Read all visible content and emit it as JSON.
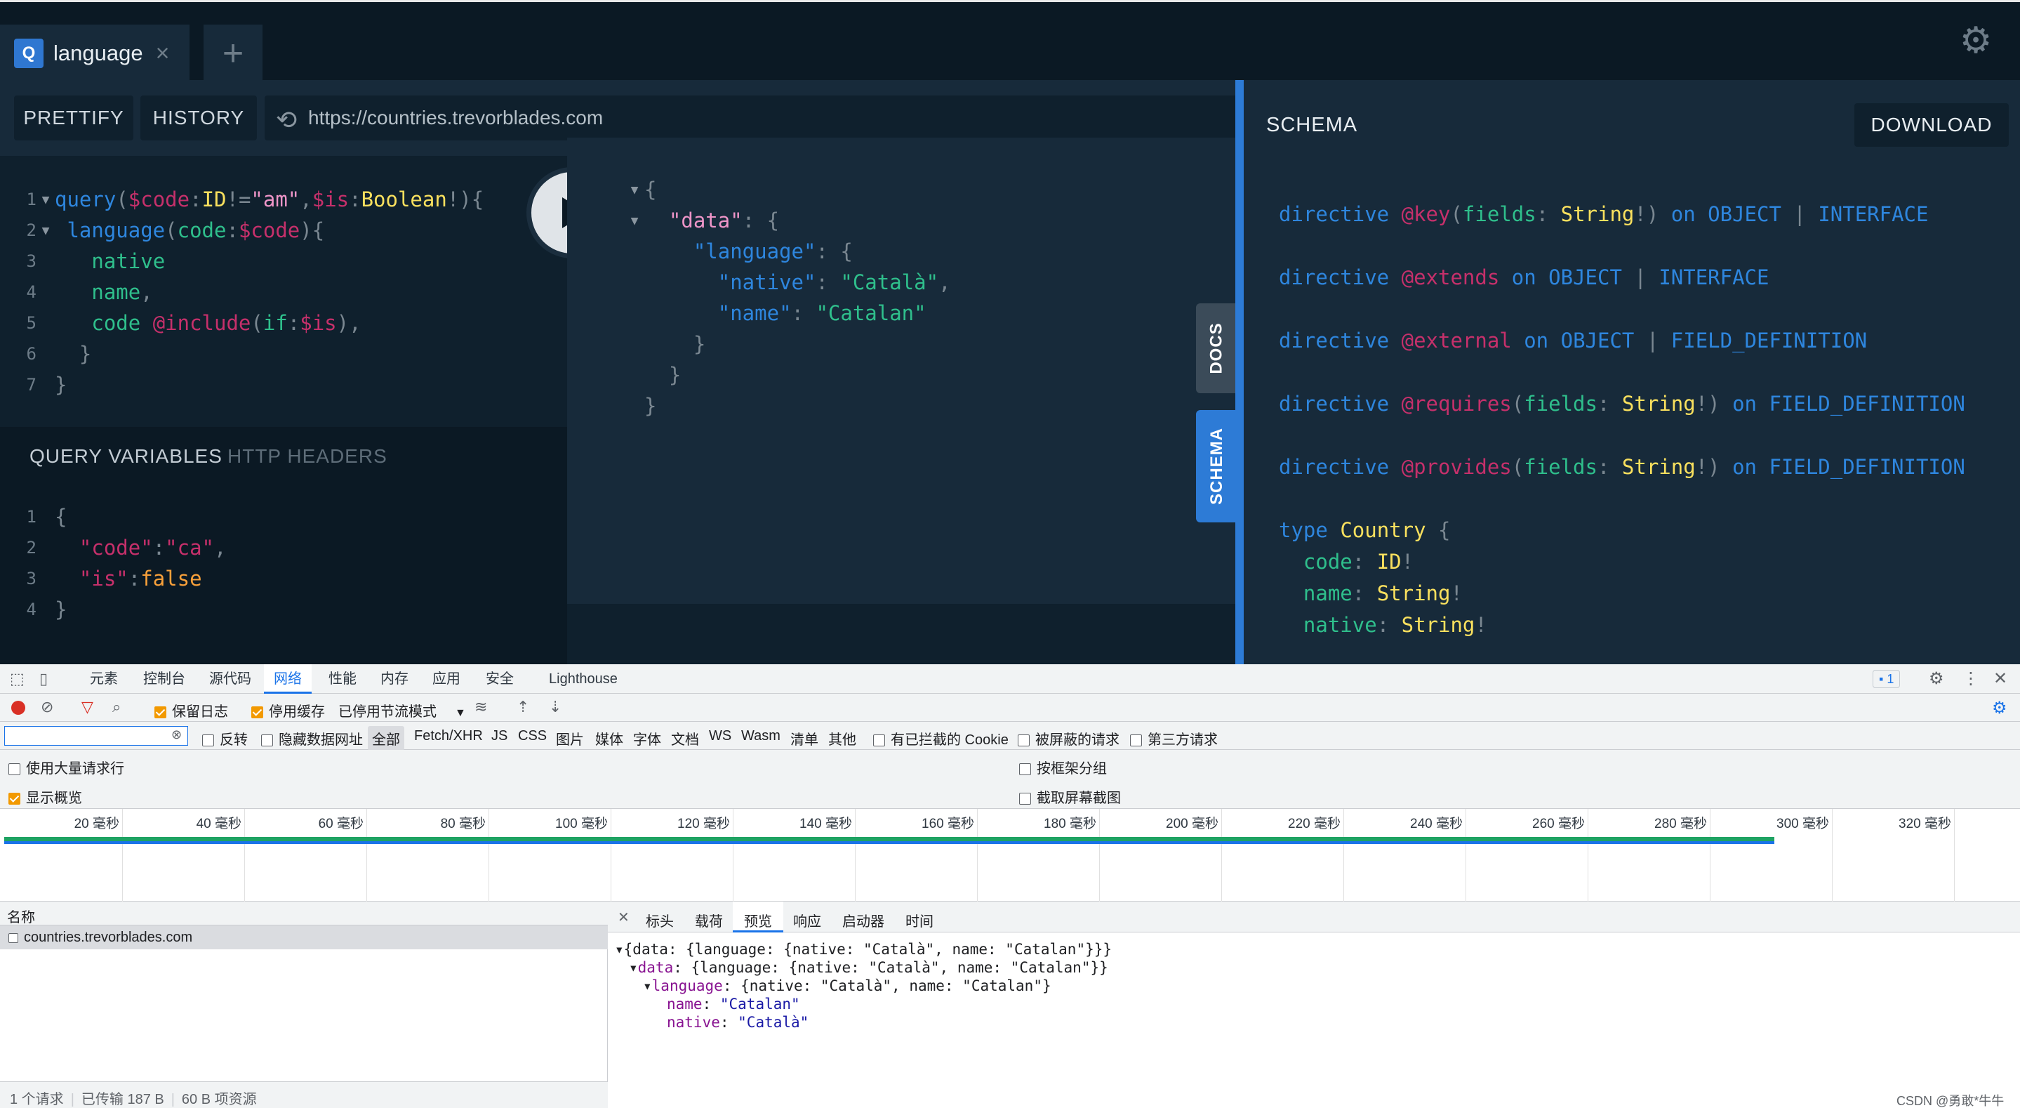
{
  "tab": {
    "icon": "Q",
    "title": "language",
    "close": "×",
    "add": "+"
  },
  "toolbar": {
    "prettify": "PRETTIFY",
    "history": "HISTORY",
    "url": "https://countries.trevorblades.com"
  },
  "settings_icon": "gear-icon",
  "query": {
    "lines": [
      "1",
      "2",
      "3",
      "4",
      "5",
      "6",
      "7"
    ]
  },
  "query_tokens": {
    "l1": [
      "query",
      "(",
      "$code",
      ":",
      "ID",
      "!",
      "=",
      "\"am\"",
      ",",
      "$is",
      ":",
      "Boolean",
      "!",
      "){"
    ],
    "l2": [
      "language",
      "(",
      "code",
      ":",
      "$code",
      "){"
    ],
    "l3": "native",
    "l4": [
      "name",
      ","
    ],
    "l5": [
      "code",
      "@include",
      "(",
      "if",
      ":",
      "$is",
      "),"
    ],
    "l6": "}",
    "l7": "}"
  },
  "vars_header": {
    "active": "QUERY VARIABLES",
    "inactive": "HTTP HEADERS"
  },
  "variables": {
    "lines": [
      "1",
      "2",
      "3",
      "4"
    ],
    "l1": "{",
    "l2k": "\"code\"",
    "l2v": "\"ca\"",
    "l3k": "\"is\"",
    "l3v": "false",
    "l4": "}"
  },
  "result": {
    "l1": "{",
    "key_data": "\"data\"",
    "key_language": "\"language\"",
    "key_native": "\"native\"",
    "val_native": "\"Català\"",
    "key_name": "\"name\"",
    "val_name": "\"Catalan\"",
    "close": "}"
  },
  "side_tabs": {
    "docs": "DOCS",
    "schema": "SCHEMA"
  },
  "schema": {
    "title": "SCHEMA",
    "download": "DOWNLOAD",
    "d1": {
      "kw": "directive",
      "name": "@key",
      "arg": "fields",
      "type": "String",
      "on": "on",
      "t1": "OBJECT",
      "t2": "INTERFACE"
    },
    "d2": {
      "kw": "directive",
      "name": "@extends",
      "on": "on",
      "t1": "OBJECT",
      "t2": "INTERFACE"
    },
    "d3": {
      "kw": "directive",
      "name": "@external",
      "on": "on",
      "t1": "OBJECT",
      "t2": "FIELD_DEFINITION"
    },
    "d4": {
      "kw": "directive",
      "name": "@requires",
      "arg": "fields",
      "type": "String",
      "on": "on",
      "t1": "FIELD_DEFINITION"
    },
    "d5": {
      "kw": "directive",
      "name": "@provides",
      "arg": "fields",
      "type": "String",
      "on": "on",
      "t1": "FIELD_DEFINITION"
    },
    "type": {
      "kw": "type",
      "name": "Country",
      "f1": "code",
      "t1": "ID",
      "f2": "name",
      "t2": "String",
      "f3": "native",
      "t3": "String"
    }
  },
  "devtools": {
    "tabs": [
      "元素",
      "控制台",
      "源代码",
      "网络",
      "性能",
      "内存",
      "应用",
      "安全",
      "Lighthouse"
    ],
    "issues_count": "1",
    "row2": {
      "preserve_log": "保留日志",
      "disable_cache": "停用缓存",
      "throttle": "已停用节流模式"
    },
    "row3": {
      "invert": "反转",
      "hide_data": "隐藏数据网址",
      "all": "全部",
      "types": [
        "Fetch/XHR",
        "JS",
        "CSS",
        "图片",
        "媒体",
        "字体",
        "文档",
        "WS",
        "Wasm",
        "清单",
        "其他"
      ],
      "blocked_cookies": "有已拦截的 Cookie",
      "blocked_requests": "被屏蔽的请求",
      "third_party": "第三方请求"
    },
    "row4": {
      "large_rows": "使用大量请求行",
      "overview": "显示概览",
      "group_by_frame": "按框架分组",
      "screenshots": "截取屏幕截图"
    },
    "timeline": [
      "20 毫秒",
      "40 毫秒",
      "60 毫秒",
      "80 毫秒",
      "100 毫秒",
      "120 毫秒",
      "140 毫秒",
      "160 毫秒",
      "180 毫秒",
      "200 毫秒",
      "220 毫秒",
      "240 毫秒",
      "260 毫秒",
      "280 毫秒",
      "300 毫秒",
      "320 毫秒"
    ],
    "name_header": "名称",
    "request": "countries.trevorblades.com",
    "detail_tabs": [
      "标头",
      "载荷",
      "预览",
      "响应",
      "启动器",
      "时间"
    ],
    "preview": {
      "l1": "{data: {language: {native: \"Català\", name: \"Catalan\"}}}",
      "l2k": "data",
      "l2v": ": {language: {native: \"Català\", name: \"Catalan\"}}",
      "l3k": "language",
      "l3v": ": {native: \"Català\", name: \"Catalan\"}",
      "l4k": "name",
      "l4v": "\"Catalan\"",
      "l5k": "native",
      "l5v": "\"Català\""
    },
    "status": {
      "requests": "1 个请求",
      "transferred": "已传输 187 B",
      "resources": "60 B 项资源"
    },
    "watermark": "CSDN @勇敢*牛牛"
  }
}
